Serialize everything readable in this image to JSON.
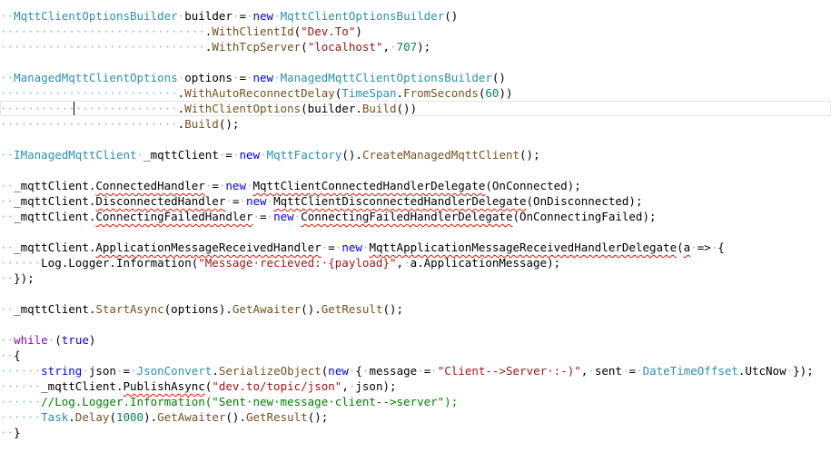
{
  "editor": {
    "lines": [
      [
        {
          "t": "··",
          "c": "ws"
        },
        {
          "t": "MqttClientOptionsBuilder",
          "c": "type"
        },
        {
          "t": "·",
          "c": "ws"
        },
        {
          "t": "builder",
          "c": "plain"
        },
        {
          "t": "·",
          "c": "ws"
        },
        {
          "t": "=",
          "c": "plain"
        },
        {
          "t": "·",
          "c": "ws"
        },
        {
          "t": "new",
          "c": "kw"
        },
        {
          "t": "·",
          "c": "ws"
        },
        {
          "t": "MqttClientOptionsBuilder",
          "c": "type"
        },
        {
          "t": "()",
          "c": "plain"
        }
      ],
      [
        {
          "t": "······························",
          "c": "ws"
        },
        {
          "t": ".",
          "c": "plain"
        },
        {
          "t": "WithClientId",
          "c": "method"
        },
        {
          "t": "(",
          "c": "plain"
        },
        {
          "t": "\"Dev.To\"",
          "c": "str"
        },
        {
          "t": ")",
          "c": "plain"
        }
      ],
      [
        {
          "t": "······························",
          "c": "ws"
        },
        {
          "t": ".",
          "c": "plain"
        },
        {
          "t": "WithTcpServer",
          "c": "method"
        },
        {
          "t": "(",
          "c": "plain"
        },
        {
          "t": "\"localhost\"",
          "c": "str"
        },
        {
          "t": ",",
          "c": "plain"
        },
        {
          "t": "·",
          "c": "ws"
        },
        {
          "t": "707",
          "c": "num"
        },
        {
          "t": ");",
          "c": "plain"
        }
      ],
      [],
      [
        {
          "t": "··",
          "c": "ws"
        },
        {
          "t": "ManagedMqttClientOptions",
          "c": "type"
        },
        {
          "t": "·",
          "c": "ws"
        },
        {
          "t": "options",
          "c": "plain"
        },
        {
          "t": "·",
          "c": "ws"
        },
        {
          "t": "=",
          "c": "plain"
        },
        {
          "t": "·",
          "c": "ws"
        },
        {
          "t": "new",
          "c": "kw"
        },
        {
          "t": "·",
          "c": "ws"
        },
        {
          "t": "ManagedMqttClientOptionsBuilder",
          "c": "type"
        },
        {
          "t": "()",
          "c": "plain"
        }
      ],
      [
        {
          "t": "··························",
          "c": "ws"
        },
        {
          "t": ".",
          "c": "plain"
        },
        {
          "t": "WithAutoReconnectDelay",
          "c": "method"
        },
        {
          "t": "(",
          "c": "plain"
        },
        {
          "t": "TimeSpan",
          "c": "type"
        },
        {
          "t": ".",
          "c": "plain"
        },
        {
          "t": "FromSeconds",
          "c": "method"
        },
        {
          "t": "(",
          "c": "plain"
        },
        {
          "t": "60",
          "c": "num"
        },
        {
          "t": "))",
          "c": "plain"
        }
      ],
      [
        {
          "t": "··························",
          "c": "ws"
        },
        {
          "t": ".",
          "c": "plain"
        },
        {
          "t": "WithClientOptions",
          "c": "method"
        },
        {
          "t": "(builder.",
          "c": "plain"
        },
        {
          "t": "Build",
          "c": "method"
        },
        {
          "t": "())",
          "c": "plain"
        }
      ],
      [
        {
          "t": "··························",
          "c": "ws"
        },
        {
          "t": ".",
          "c": "plain"
        },
        {
          "t": "Build",
          "c": "method"
        },
        {
          "t": "();",
          "c": "plain"
        }
      ],
      [],
      [
        {
          "t": "··",
          "c": "ws"
        },
        {
          "t": "IManagedMqttClient",
          "c": "type"
        },
        {
          "t": "·",
          "c": "ws"
        },
        {
          "t": "_mqttClient",
          "c": "plain"
        },
        {
          "t": "·",
          "c": "ws"
        },
        {
          "t": "=",
          "c": "plain"
        },
        {
          "t": "·",
          "c": "ws"
        },
        {
          "t": "new",
          "c": "kw"
        },
        {
          "t": "·",
          "c": "ws"
        },
        {
          "t": "MqttFactory",
          "c": "type"
        },
        {
          "t": "().",
          "c": "plain"
        },
        {
          "t": "CreateManagedMqttClient",
          "c": "method"
        },
        {
          "t": "();",
          "c": "plain"
        }
      ],
      [],
      [
        {
          "t": "··",
          "c": "ws"
        },
        {
          "t": "_mqttClient.",
          "c": "plain"
        },
        {
          "t": "ConnectedHandler",
          "c": "plain",
          "s": 1
        },
        {
          "t": "·",
          "c": "ws"
        },
        {
          "t": "=",
          "c": "plain"
        },
        {
          "t": "·",
          "c": "ws"
        },
        {
          "t": "new",
          "c": "kw"
        },
        {
          "t": "·",
          "c": "ws"
        },
        {
          "t": "MqttClientConnectedHandlerDelegate",
          "c": "plain",
          "s": 1
        },
        {
          "t": "(OnConnected);",
          "c": "plain"
        }
      ],
      [
        {
          "t": "··",
          "c": "ws"
        },
        {
          "t": "_mqttClient.",
          "c": "plain"
        },
        {
          "t": "DisconnectedHandler",
          "c": "plain",
          "s": 1
        },
        {
          "t": "·",
          "c": "ws"
        },
        {
          "t": "=",
          "c": "plain"
        },
        {
          "t": "·",
          "c": "ws"
        },
        {
          "t": "new",
          "c": "kw"
        },
        {
          "t": "·",
          "c": "ws"
        },
        {
          "t": "MqttClientDisconnectedHandlerDelegate",
          "c": "plain",
          "s": 1
        },
        {
          "t": "(OnDisconnected);",
          "c": "plain"
        }
      ],
      [
        {
          "t": "··",
          "c": "ws"
        },
        {
          "t": "_mqttClient.",
          "c": "plain"
        },
        {
          "t": "ConnectingFailedHandler",
          "c": "plain",
          "s": 1
        },
        {
          "t": "·",
          "c": "ws"
        },
        {
          "t": "=",
          "c": "plain"
        },
        {
          "t": "·",
          "c": "ws"
        },
        {
          "t": "new",
          "c": "kw"
        },
        {
          "t": "·",
          "c": "ws"
        },
        {
          "t": "ConnectingFailedHandlerDelegate",
          "c": "plain",
          "s": 1
        },
        {
          "t": "(OnConnectingFailed);",
          "c": "plain"
        }
      ],
      [],
      [
        {
          "t": "··",
          "c": "ws"
        },
        {
          "t": "_mqttClient.",
          "c": "plain"
        },
        {
          "t": "ApplicationMessageReceivedHandler",
          "c": "plain",
          "s": 1
        },
        {
          "t": "·",
          "c": "ws"
        },
        {
          "t": "=",
          "c": "plain"
        },
        {
          "t": "·",
          "c": "ws"
        },
        {
          "t": "new",
          "c": "kw"
        },
        {
          "t": "·",
          "c": "ws"
        },
        {
          "t": "MqttApplicationMessageReceivedHandlerDelegate",
          "c": "plain",
          "s": 1
        },
        {
          "t": "(",
          "c": "plain"
        },
        {
          "t": "a",
          "c": "plain",
          "s": 1
        },
        {
          "t": "·",
          "c": "ws"
        },
        {
          "t": "=>",
          "c": "plain"
        },
        {
          "t": "·",
          "c": "ws"
        },
        {
          "t": "{",
          "c": "plain"
        }
      ],
      [
        {
          "t": "······",
          "c": "ws"
        },
        {
          "t": "Log.Logger.Information(",
          "c": "plain"
        },
        {
          "t": "\"Message·recieved:·{payload}\"",
          "c": "str"
        },
        {
          "t": ",",
          "c": "plain"
        },
        {
          "t": "·",
          "c": "ws"
        },
        {
          "t": "a.ApplicationMessage);",
          "c": "plain"
        }
      ],
      [
        {
          "t": "··",
          "c": "ws"
        },
        {
          "t": "});",
          "c": "plain"
        }
      ],
      [],
      [
        {
          "t": "··",
          "c": "ws"
        },
        {
          "t": "_mqttClient.",
          "c": "plain"
        },
        {
          "t": "StartAsync",
          "c": "method"
        },
        {
          "t": "(options).",
          "c": "plain"
        },
        {
          "t": "GetAwaiter",
          "c": "method"
        },
        {
          "t": "().",
          "c": "plain"
        },
        {
          "t": "GetResult",
          "c": "method"
        },
        {
          "t": "();",
          "c": "plain"
        }
      ],
      [],
      [
        {
          "t": "··",
          "c": "ws"
        },
        {
          "t": "while",
          "c": "kwc"
        },
        {
          "t": "·",
          "c": "ws"
        },
        {
          "t": "(",
          "c": "plain"
        },
        {
          "t": "true",
          "c": "kw"
        },
        {
          "t": ")",
          "c": "plain"
        }
      ],
      [
        {
          "t": "··",
          "c": "ws"
        },
        {
          "t": "{",
          "c": "plain"
        }
      ],
      [
        {
          "t": "······",
          "c": "ws"
        },
        {
          "t": "string",
          "c": "kw"
        },
        {
          "t": "·",
          "c": "ws"
        },
        {
          "t": "json",
          "c": "plain"
        },
        {
          "t": "·",
          "c": "ws"
        },
        {
          "t": "=",
          "c": "plain"
        },
        {
          "t": "·",
          "c": "ws"
        },
        {
          "t": "JsonConvert",
          "c": "type"
        },
        {
          "t": ".",
          "c": "plain"
        },
        {
          "t": "SerializeObject",
          "c": "method"
        },
        {
          "t": "(",
          "c": "plain"
        },
        {
          "t": "new",
          "c": "kw"
        },
        {
          "t": "·",
          "c": "ws"
        },
        {
          "t": "{",
          "c": "plain"
        },
        {
          "t": "·",
          "c": "ws"
        },
        {
          "t": "message",
          "c": "plain"
        },
        {
          "t": "·",
          "c": "ws"
        },
        {
          "t": "=",
          "c": "plain"
        },
        {
          "t": "·",
          "c": "ws"
        },
        {
          "t": "\"Client-->Server·:-)\"",
          "c": "str"
        },
        {
          "t": ",",
          "c": "plain"
        },
        {
          "t": "·",
          "c": "ws"
        },
        {
          "t": "sent",
          "c": "plain"
        },
        {
          "t": "·",
          "c": "ws"
        },
        {
          "t": "=",
          "c": "plain"
        },
        {
          "t": "·",
          "c": "ws"
        },
        {
          "t": "DateTimeOffset",
          "c": "type"
        },
        {
          "t": ".UtcNow",
          "c": "plain"
        },
        {
          "t": "·",
          "c": "ws"
        },
        {
          "t": "});",
          "c": "plain"
        }
      ],
      [
        {
          "t": "······",
          "c": "ws"
        },
        {
          "t": "_mqttClient.",
          "c": "plain"
        },
        {
          "t": "PublishAsync",
          "c": "plain",
          "s": 1
        },
        {
          "t": "(",
          "c": "plain"
        },
        {
          "t": "\"dev.to/topic/json\"",
          "c": "str"
        },
        {
          "t": ",",
          "c": "plain"
        },
        {
          "t": "·",
          "c": "ws"
        },
        {
          "t": "json);",
          "c": "plain"
        }
      ],
      [
        {
          "t": "······",
          "c": "ws"
        },
        {
          "t": "//Log.Logger.Information(\"Sent·new·message·client-->server\");",
          "c": "comment"
        }
      ],
      [
        {
          "t": "······",
          "c": "ws"
        },
        {
          "t": "Task",
          "c": "type"
        },
        {
          "t": ".",
          "c": "plain"
        },
        {
          "t": "Delay",
          "c": "method"
        },
        {
          "t": "(",
          "c": "plain"
        },
        {
          "t": "1000",
          "c": "num"
        },
        {
          "t": ").",
          "c": "plain"
        },
        {
          "t": "GetAwaiter",
          "c": "method"
        },
        {
          "t": "().",
          "c": "plain"
        },
        {
          "t": "GetResult",
          "c": "method"
        },
        {
          "t": "();",
          "c": "plain"
        }
      ],
      [
        {
          "t": "··",
          "c": "ws"
        },
        {
          "t": "}",
          "c": "plain"
        }
      ]
    ]
  }
}
